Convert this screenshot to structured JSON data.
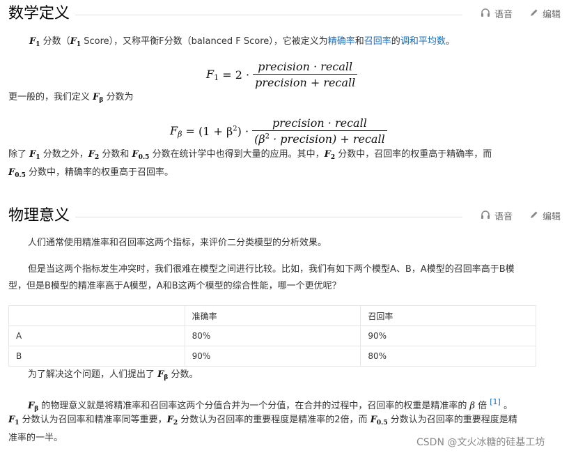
{
  "section1": {
    "title": "数学定义",
    "voice_label": "语音",
    "edit_label": "编辑",
    "intro": {
      "f1": "F",
      "f1_sub": "1",
      "t1": " 分数（",
      "t2": " Score），又称平衡F分数（balanced F Score），它被定义为",
      "link1": "精确率",
      "t3": "和",
      "link2": "召回率",
      "t4": "的",
      "link3": "调和平均数",
      "t5": "。"
    },
    "formula1": {
      "lhs": "F",
      "lhs_sub": "1",
      "eq": " = 2 · ",
      "num": "precision · recall",
      "den": "precision + recall"
    },
    "general_text": {
      "t1": "更一般的，我们定义 ",
      "fb": "F",
      "fb_sub": "β",
      "t2": " 分数为"
    },
    "formula2": {
      "lhs": "F",
      "lhs_sub": "β",
      "eq": " = (1 + β",
      "sq": "2",
      "eq2": ") · ",
      "num": "precision · recall",
      "den_a": "(β",
      "den_sq": "2",
      "den_b": " · precision) + recall"
    },
    "extra": {
      "t1": "除了 ",
      "t2": " 分数之外，",
      "t3": " 分数和 ",
      "t4": " 分数在统计学中也得到大量的应用。其中，",
      "t5": " 分数中，召回率的权重高于精确率，而",
      "t6": " 分数中，精确率的权重高于召回率。",
      "F": "F",
      "s1": "1",
      "s2": "2",
      "s05": "0.5"
    }
  },
  "section2": {
    "title": "物理意义",
    "voice_label": "语音",
    "edit_label": "编辑",
    "p1": "人们通常使用精准率和召回率这两个指标，来评价二分类模型的分析效果。",
    "p2_line1": "但是当这两个指标发生冲突时，我们很难在模型之间进行比较。比如，我们有如下两个模型A、B，A模型的召回率高于B模",
    "p2_line2": "型，但是B模型的精准率高于A模型，A和B这两个模型的综合性能，哪一个更优呢？",
    "table": {
      "headers": [
        "",
        "准确率",
        "召回率"
      ],
      "rows": [
        [
          "A",
          "80%",
          "90%"
        ],
        [
          "B",
          "90%",
          "80%"
        ]
      ]
    },
    "p3": {
      "t1": "为了解决这个问题，人们提出了 ",
      "F": "F",
      "sub": "β",
      "t2": " 分数。"
    },
    "p4": {
      "F": "F",
      "sub": "β",
      "t1": " 的物理意义就是将精准率和召回率这两个分值合并为一个分值，在合并的过程中，召回率的权重是精准率的 ",
      "beta": "β",
      "t2": " 倍 ",
      "ref": "[1]",
      "t3": " 。",
      "line2_a": " 分数认为召回率和精准率同等重要，",
      "line2_b": " 分数认为召回率的重要程度是精准率的2倍，而 ",
      "line2_c": " 分数认为召回率的重要程度是精",
      "line3": "准率的一半。",
      "s1": "1",
      "s2": "2",
      "s05": "0.5"
    }
  },
  "watermark": "CSDN @文火冰糖的硅基工坊",
  "colors": {
    "link": "#136ec2",
    "text": "#333333",
    "rule": "#e0e0e0"
  },
  "icons": [
    "headphones-icon",
    "pencil-icon"
  ]
}
